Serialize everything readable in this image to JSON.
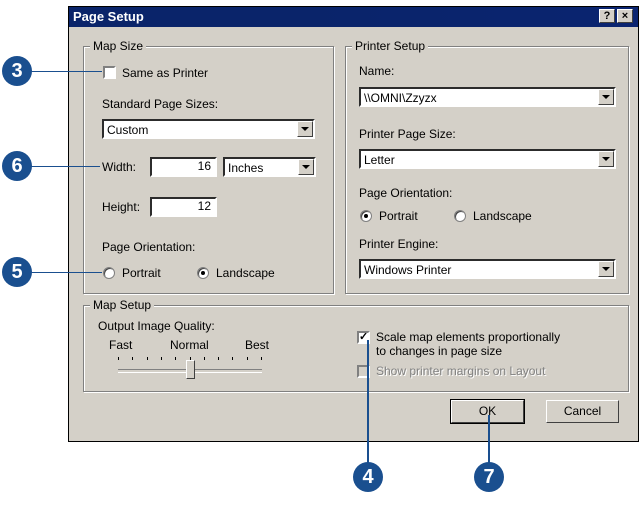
{
  "window": {
    "title": "Page Setup",
    "help_button": "?",
    "close_button": "×"
  },
  "map_size": {
    "group_label": "Map Size",
    "same_as_printer_label": "Same as Printer",
    "same_as_printer_checked": false,
    "standard_page_sizes_label": "Standard Page Sizes:",
    "standard_page_size_value": "Custom",
    "width_label": "Width:",
    "width_value": "16",
    "units_value": "Inches",
    "height_label": "Height:",
    "height_value": "12",
    "orientation_label": "Page Orientation:",
    "portrait_label": "Portrait",
    "landscape_label": "Landscape",
    "selected_orientation": "Landscape"
  },
  "printer_setup": {
    "group_label": "Printer Setup",
    "name_label": "Name:",
    "name_value": "\\\\OMNI\\Zzyzx",
    "printer_page_size_label": "Printer Page Size:",
    "printer_page_size_value": "Letter",
    "orientation_label": "Page Orientation:",
    "portrait_label": "Portrait",
    "landscape_label": "Landscape",
    "selected_orientation": "Portrait",
    "printer_engine_label": "Printer Engine:",
    "printer_engine_value": "Windows Printer"
  },
  "map_setup": {
    "group_label": "Map Setup",
    "output_quality_label": "Output Image Quality:",
    "fast_label": "Fast",
    "normal_label": "Normal",
    "best_label": "Best",
    "quality_level": 0.5,
    "scale_elements_label_line1": "Scale map elements proportionally",
    "scale_elements_label_line2": "to changes in page size",
    "scale_elements_checked": true,
    "show_margins_label": "Show printer margins on Layout",
    "show_margins_checked": false
  },
  "buttons": {
    "ok": "OK",
    "cancel": "Cancel"
  },
  "callouts": {
    "c3": "3",
    "c6": "6",
    "c5": "5",
    "c4": "4",
    "c7": "7"
  },
  "colors": {
    "callout": "#1a4f8f",
    "titlebar": "#0a246a",
    "face": "#d4d0c8"
  }
}
